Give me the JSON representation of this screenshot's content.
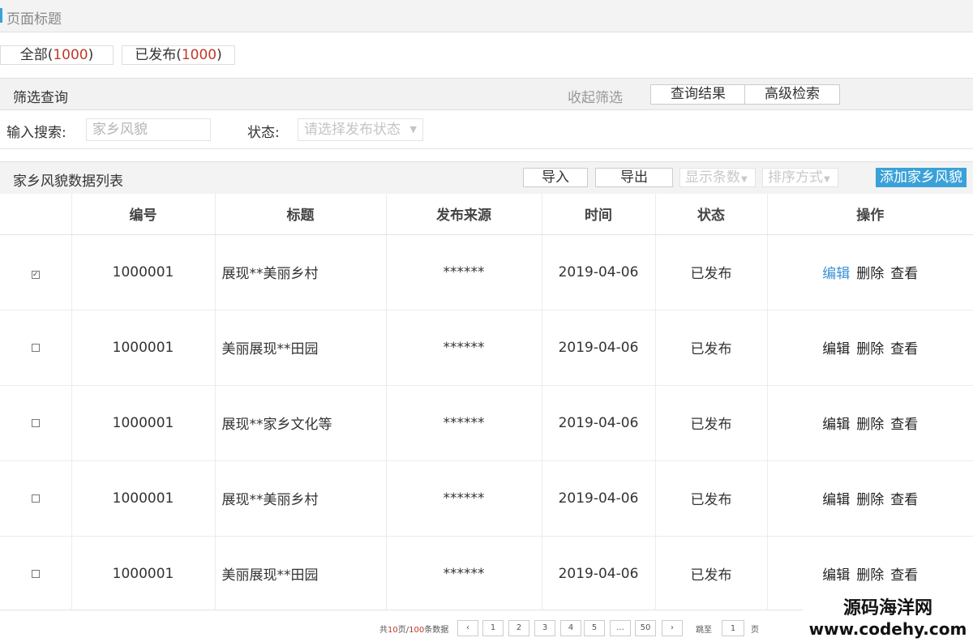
{
  "page_title": "页面标题",
  "tabs": [
    {
      "label": "全部(",
      "count": "1000",
      "suffix": ")"
    },
    {
      "label": "已发布(",
      "count": "1000",
      "suffix": ")"
    }
  ],
  "filter": {
    "title": "筛选查询",
    "collapse_label": "收起筛选",
    "query_button": "查询结果",
    "advanced_button": "高级检索",
    "search_label": "输入搜索:",
    "search_placeholder": "家乡风貌",
    "status_label": "状态:",
    "status_placeholder": "请选择发布状态"
  },
  "list": {
    "title": "家乡风貌数据列表",
    "import_button": "导入",
    "export_button": "导出",
    "display_count_label": "显示条数",
    "sort_label": "排序方式",
    "add_button": "添加家乡风貌"
  },
  "table": {
    "columns": [
      "",
      "编号",
      "标题",
      "发布来源",
      "时间",
      "状态",
      "操作"
    ],
    "rows": [
      {
        "checked": true,
        "id": "1000001",
        "title": "展现**美丽乡村",
        "source": "******",
        "date": "2019-04-06",
        "status": "已发布"
      },
      {
        "checked": false,
        "id": "1000001",
        "title": "美丽展现**田园",
        "source": "******",
        "date": "2019-04-06",
        "status": "已发布"
      },
      {
        "checked": false,
        "id": "1000001",
        "title": "展现**家乡文化等",
        "source": "******",
        "date": "2019-04-06",
        "status": "已发布"
      },
      {
        "checked": false,
        "id": "1000001",
        "title": "展现**美丽乡村",
        "source": "******",
        "date": "2019-04-06",
        "status": "已发布"
      },
      {
        "checked": false,
        "id": "1000001",
        "title": "美丽展现**田园",
        "source": "******",
        "date": "2019-04-06",
        "status": "已发布"
      }
    ],
    "actions": {
      "edit": "编辑",
      "delete": "删除",
      "view": "查看"
    }
  },
  "pagination": {
    "summary_prefix": "共",
    "total_pages": "10",
    "summary_mid": "页/",
    "total_items": "100",
    "summary_suffix": "条数据",
    "prev": "‹",
    "pages": [
      "1",
      "2",
      "3",
      "4",
      "5",
      "...",
      "50"
    ],
    "next": "›",
    "jump_label": "跳至",
    "jump_value": "1",
    "jump_unit": "页"
  },
  "watermark": {
    "name": "源码海洋网",
    "url": "www.codehy.com"
  },
  "colors": {
    "accent": "#3aa1d8",
    "count_red": "#c0392b",
    "link_blue": "#3a8fd6"
  }
}
